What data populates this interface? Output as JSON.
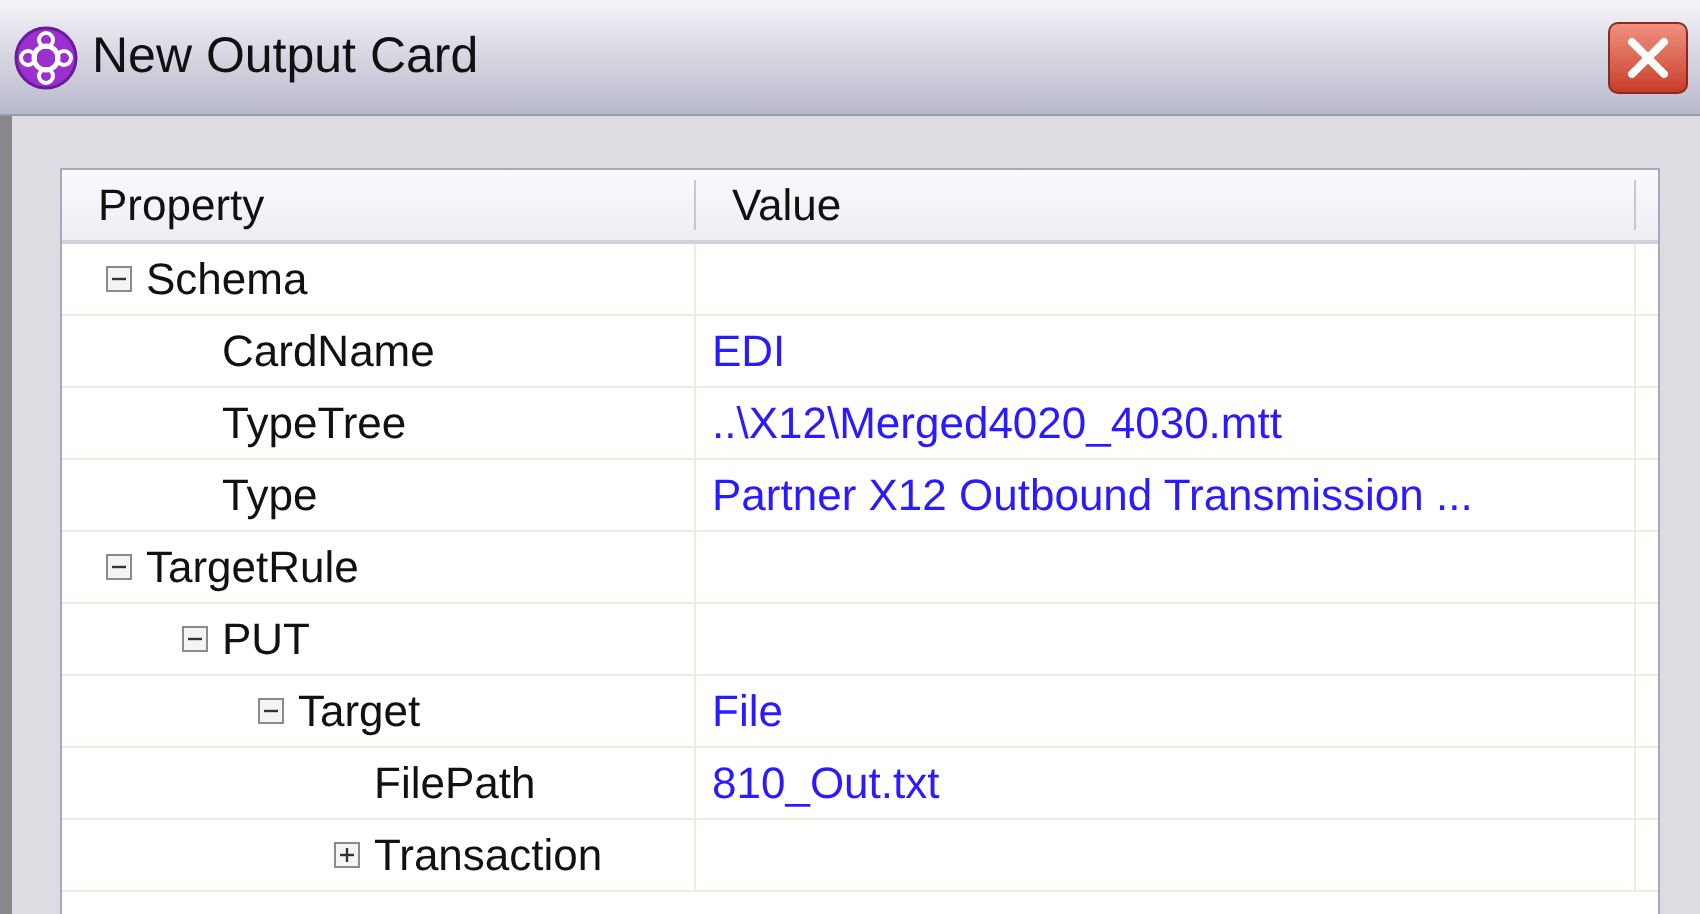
{
  "window": {
    "title": "New Output Card"
  },
  "grid": {
    "columns": [
      "Property",
      "Value"
    ],
    "rows": [
      {
        "property": "Schema",
        "expanded": true,
        "children": [
          {
            "property": "CardName",
            "value": "EDI"
          },
          {
            "property": "TypeTree",
            "value": "..\\X12\\Merged4020_4030.mtt"
          },
          {
            "property": "Type",
            "value": "Partner X12 Outbound Transmission ..."
          }
        ]
      },
      {
        "property": "TargetRule",
        "expanded": true,
        "children": [
          {
            "property": "PUT",
            "expanded": true,
            "children": [
              {
                "property": "Target",
                "value": "File",
                "expanded": true,
                "children": [
                  {
                    "property": "FilePath",
                    "value": "810_Out.txt"
                  },
                  {
                    "property": "Transaction",
                    "expanded": false
                  }
                ]
              }
            ]
          }
        ]
      }
    ]
  }
}
